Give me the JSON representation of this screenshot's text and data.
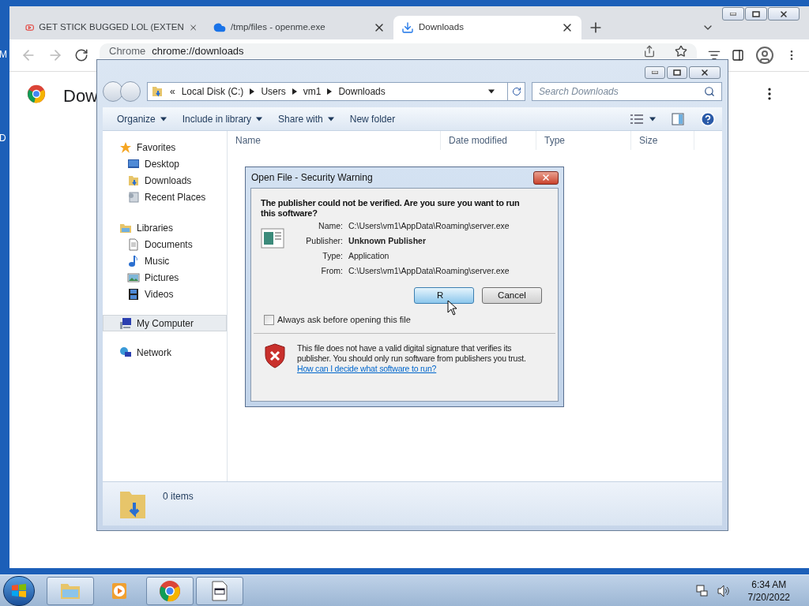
{
  "desktop": {
    "icon_labels": [
      "M",
      "D"
    ]
  },
  "chrome": {
    "tabs": [
      {
        "title": "GET STICK BUGGED LOL (EXTEN",
        "kind": "video",
        "selected": false
      },
      {
        "title": "/tmp/files - openme.exe",
        "kind": "cloud",
        "selected": false
      },
      {
        "title": "Downloads",
        "kind": "download",
        "selected": true
      }
    ],
    "address": {
      "site": "Chrome",
      "url": "chrome://downloads"
    },
    "page_title": "Dow"
  },
  "explorer": {
    "overflow": "«",
    "breadcrumb": [
      "Local Disk (C:)",
      "Users",
      "vm1",
      "Downloads"
    ],
    "search": {
      "placeholder": "Search Downloads"
    },
    "commands": [
      {
        "label": "Organize",
        "dropdown": true
      },
      {
        "label": "Include in library",
        "dropdown": true
      },
      {
        "label": "Share with",
        "dropdown": true
      },
      {
        "label": "New folder",
        "dropdown": false
      }
    ],
    "columns": [
      "Name",
      "Date modified",
      "Type",
      "Size"
    ],
    "nav": [
      {
        "label": "Favorites",
        "kind": "star",
        "selected": false,
        "children": [
          {
            "label": "Desktop",
            "kind": "desktop",
            "selected": false
          },
          {
            "label": "Downloads",
            "kind": "download-folder",
            "selected": false
          },
          {
            "label": "Recent Places",
            "kind": "recent",
            "selected": false
          }
        ]
      },
      {
        "label": "Libraries",
        "kind": "library",
        "selected": false,
        "children": [
          {
            "label": "Documents",
            "kind": "document",
            "selected": false
          },
          {
            "label": "Music",
            "kind": "music",
            "selected": false
          },
          {
            "label": "Pictures",
            "kind": "pictures",
            "selected": false
          },
          {
            "label": "Videos",
            "kind": "videos",
            "selected": false
          }
        ]
      },
      {
        "label": "My Computer",
        "kind": "computer",
        "selected": true
      },
      {
        "label": "Network",
        "kind": "network",
        "selected": false
      }
    ],
    "status": "0 items"
  },
  "dialog": {
    "title": "Open File - Security Warning",
    "heading": "The publisher could not be verified.  Are you sure you want to run this software?",
    "fields": [
      {
        "label": "Name:",
        "value": "C:\\Users\\vm1\\AppData\\Roaming\\server.exe",
        "bold": false
      },
      {
        "label": "Publisher:",
        "value": "Unknown Publisher",
        "bold": true
      },
      {
        "label": "Type:",
        "value": "Application",
        "bold": false
      },
      {
        "label": "From:",
        "value": "C:\\Users\\vm1\\AppData\\Roaming\\server.exe",
        "bold": false
      }
    ],
    "buttons": [
      {
        "label": "R",
        "default": true
      },
      {
        "label": "Cancel",
        "default": false
      }
    ],
    "checkbox": {
      "label": "Always ask before opening this file",
      "checked": false
    },
    "warning": "This file does not have a valid digital signature that verifies its publisher.  You should only run software from publishers you trust.",
    "link": "How can I decide what software to run?"
  },
  "taskbar": {
    "items": [
      {
        "kind": "folder",
        "open": true
      },
      {
        "kind": "media",
        "open": false
      },
      {
        "kind": "chrome",
        "open": true
      },
      {
        "kind": "exe",
        "open": true
      }
    ],
    "time": "6:34 AM",
    "date": "7/20/2022"
  }
}
